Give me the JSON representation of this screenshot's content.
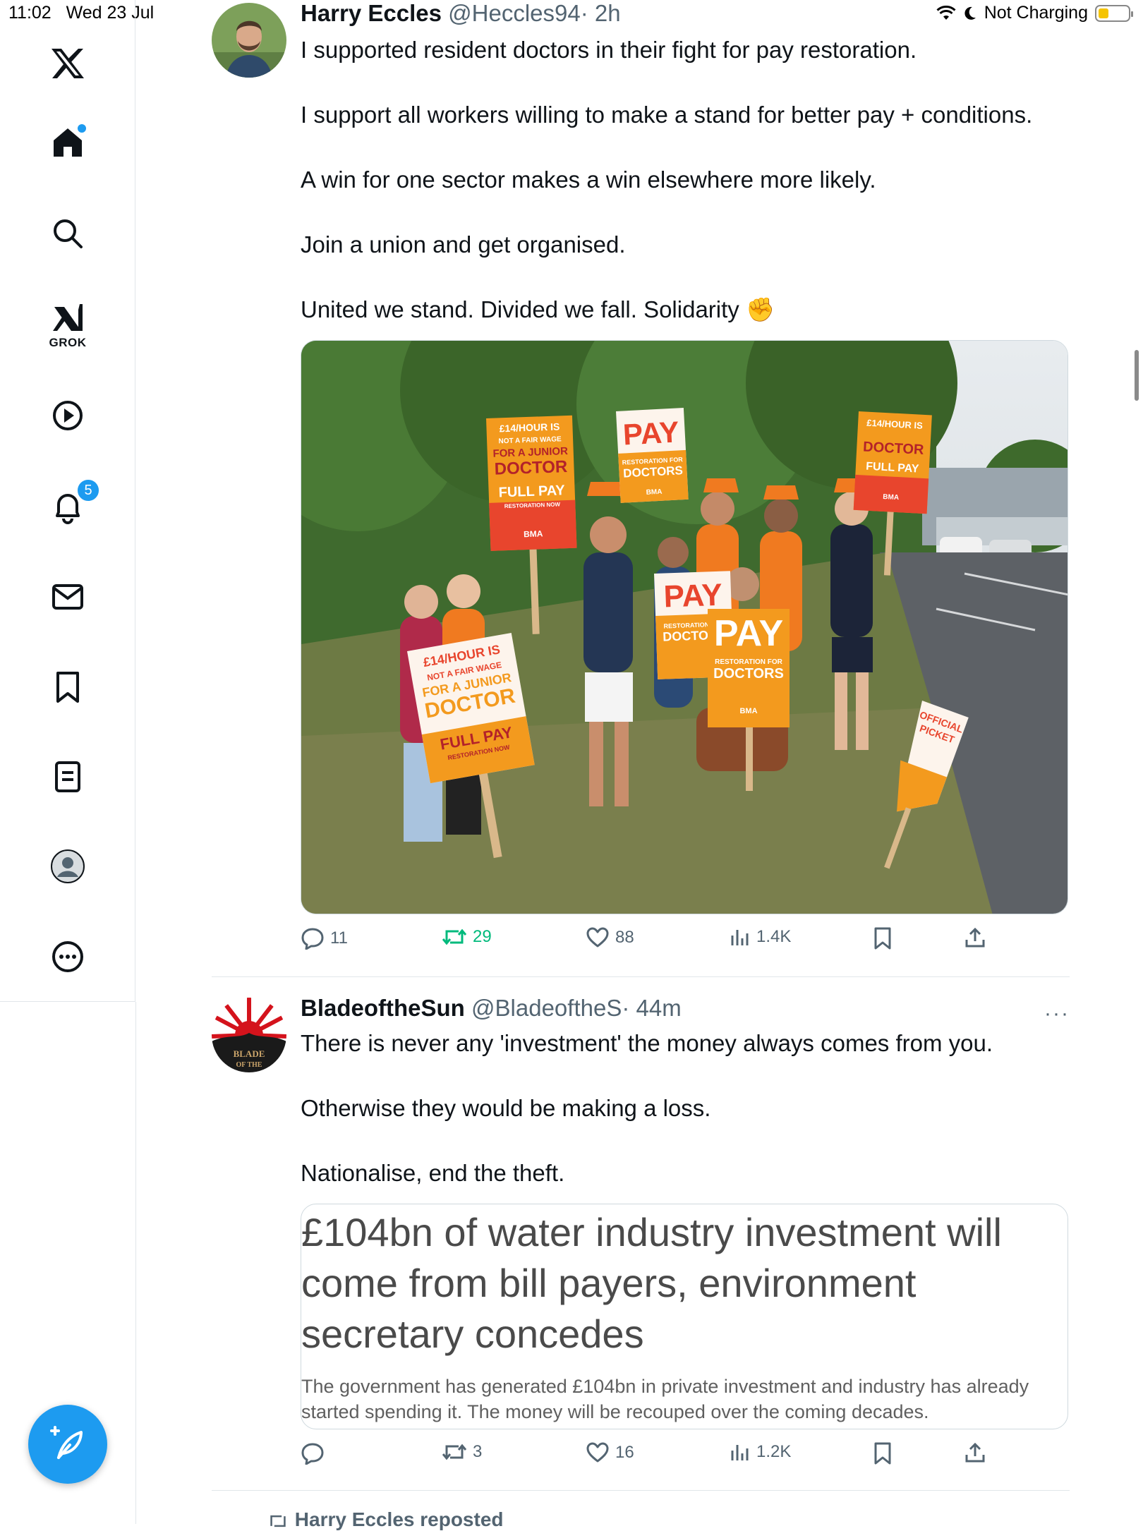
{
  "status_bar": {
    "time": "11:02",
    "date": "Wed 23 Jul",
    "charging": "Not Charging",
    "battery_level": 0.3
  },
  "sidebar": {
    "grok_label": "GROK",
    "notifications_count": "5",
    "items": [
      "x-logo-icon",
      "home-icon",
      "search-icon",
      "grok-icon",
      "video-icon",
      "notifications-icon",
      "messages-icon",
      "bookmarks-icon",
      "lists-icon",
      "profile-icon",
      "more-icon"
    ]
  },
  "posts": [
    {
      "author_name": "Harry Eccles",
      "handle": "@Heccles94",
      "time": "· 2h",
      "text": "I supported resident doctors in their fight for pay restoration.\n\nI support all workers willing to make a stand for better pay + conditions.\n\nA win for one sector makes a win elsewhere more likely.\n\nJoin a union and get organised.\n\nUnited we stand. Divided we fall. Solidarity ✊",
      "media_signs": {
        "sign_a_line1": "£14/HOUR IS",
        "sign_a_line2": "NOT A FAIR WAGE",
        "sign_a_line3": "FOR A JUNIOR",
        "sign_a_line4": "DOCTOR",
        "sign_a_line5": "FULL PAY",
        "sign_a_line6": "RESTORATION NOW",
        "sign_pay": "PAY",
        "sign_pay_sub1": "RESTORATION FOR",
        "sign_pay_sub2": "DOCTORS",
        "sign_bma": "BMA",
        "sign_picket1": "OFFICIAL",
        "sign_picket2": "PICKET"
      },
      "actions": {
        "replies": "11",
        "reposts": "29",
        "likes": "88",
        "views": "1.4K"
      }
    },
    {
      "author_name": "BladeoftheSun",
      "handle": "@BladeoftheS",
      "time": "· 44m",
      "text": "There is never any 'investment' the money always comes from you.\n\nOtherwise they would be making a loss.\n\nNationalise, end the theft.",
      "link_card": {
        "headline": "£104bn of water industry investment will come from bill payers, environment secretary concedes",
        "description": "The government has generated £104bn in private investment and industry has already started spending it. The money will be recouped over the coming decades."
      },
      "actions": {
        "replies": "",
        "reposts": "3",
        "likes": "16",
        "views": "1.2K"
      }
    }
  ],
  "next_item": {
    "repost_label": "Harry Eccles reposted"
  },
  "colors": {
    "accent": "#1d9bf0",
    "repost_green": "#00ba7c",
    "muted": "#536471",
    "sign_orange": "#f39a1e",
    "sign_red": "#e8452d"
  }
}
